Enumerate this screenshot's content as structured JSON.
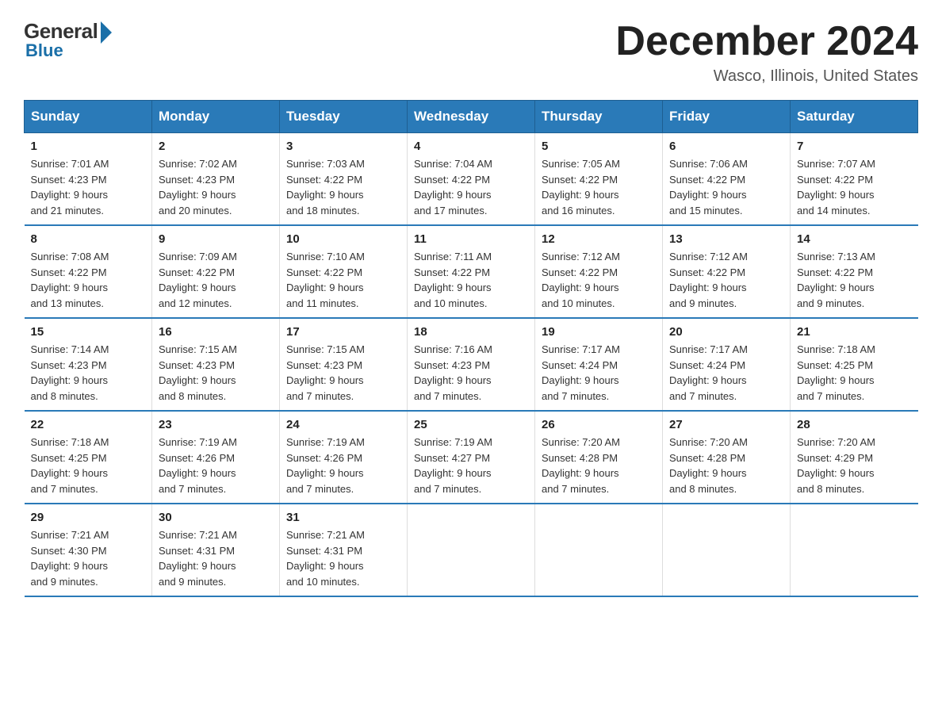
{
  "header": {
    "logo_general": "General",
    "logo_blue": "Blue",
    "month_title": "December 2024",
    "location": "Wasco, Illinois, United States"
  },
  "days_of_week": [
    "Sunday",
    "Monday",
    "Tuesday",
    "Wednesday",
    "Thursday",
    "Friday",
    "Saturday"
  ],
  "weeks": [
    [
      {
        "num": "1",
        "sunrise": "7:01 AM",
        "sunset": "4:23 PM",
        "daylight": "9 hours and 21 minutes."
      },
      {
        "num": "2",
        "sunrise": "7:02 AM",
        "sunset": "4:23 PM",
        "daylight": "9 hours and 20 minutes."
      },
      {
        "num": "3",
        "sunrise": "7:03 AM",
        "sunset": "4:22 PM",
        "daylight": "9 hours and 18 minutes."
      },
      {
        "num": "4",
        "sunrise": "7:04 AM",
        "sunset": "4:22 PM",
        "daylight": "9 hours and 17 minutes."
      },
      {
        "num": "5",
        "sunrise": "7:05 AM",
        "sunset": "4:22 PM",
        "daylight": "9 hours and 16 minutes."
      },
      {
        "num": "6",
        "sunrise": "7:06 AM",
        "sunset": "4:22 PM",
        "daylight": "9 hours and 15 minutes."
      },
      {
        "num": "7",
        "sunrise": "7:07 AM",
        "sunset": "4:22 PM",
        "daylight": "9 hours and 14 minutes."
      }
    ],
    [
      {
        "num": "8",
        "sunrise": "7:08 AM",
        "sunset": "4:22 PM",
        "daylight": "9 hours and 13 minutes."
      },
      {
        "num": "9",
        "sunrise": "7:09 AM",
        "sunset": "4:22 PM",
        "daylight": "9 hours and 12 minutes."
      },
      {
        "num": "10",
        "sunrise": "7:10 AM",
        "sunset": "4:22 PM",
        "daylight": "9 hours and 11 minutes."
      },
      {
        "num": "11",
        "sunrise": "7:11 AM",
        "sunset": "4:22 PM",
        "daylight": "9 hours and 10 minutes."
      },
      {
        "num": "12",
        "sunrise": "7:12 AM",
        "sunset": "4:22 PM",
        "daylight": "9 hours and 10 minutes."
      },
      {
        "num": "13",
        "sunrise": "7:12 AM",
        "sunset": "4:22 PM",
        "daylight": "9 hours and 9 minutes."
      },
      {
        "num": "14",
        "sunrise": "7:13 AM",
        "sunset": "4:22 PM",
        "daylight": "9 hours and 9 minutes."
      }
    ],
    [
      {
        "num": "15",
        "sunrise": "7:14 AM",
        "sunset": "4:23 PM",
        "daylight": "9 hours and 8 minutes."
      },
      {
        "num": "16",
        "sunrise": "7:15 AM",
        "sunset": "4:23 PM",
        "daylight": "9 hours and 8 minutes."
      },
      {
        "num": "17",
        "sunrise": "7:15 AM",
        "sunset": "4:23 PM",
        "daylight": "9 hours and 7 minutes."
      },
      {
        "num": "18",
        "sunrise": "7:16 AM",
        "sunset": "4:23 PM",
        "daylight": "9 hours and 7 minutes."
      },
      {
        "num": "19",
        "sunrise": "7:17 AM",
        "sunset": "4:24 PM",
        "daylight": "9 hours and 7 minutes."
      },
      {
        "num": "20",
        "sunrise": "7:17 AM",
        "sunset": "4:24 PM",
        "daylight": "9 hours and 7 minutes."
      },
      {
        "num": "21",
        "sunrise": "7:18 AM",
        "sunset": "4:25 PM",
        "daylight": "9 hours and 7 minutes."
      }
    ],
    [
      {
        "num": "22",
        "sunrise": "7:18 AM",
        "sunset": "4:25 PM",
        "daylight": "9 hours and 7 minutes."
      },
      {
        "num": "23",
        "sunrise": "7:19 AM",
        "sunset": "4:26 PM",
        "daylight": "9 hours and 7 minutes."
      },
      {
        "num": "24",
        "sunrise": "7:19 AM",
        "sunset": "4:26 PM",
        "daylight": "9 hours and 7 minutes."
      },
      {
        "num": "25",
        "sunrise": "7:19 AM",
        "sunset": "4:27 PM",
        "daylight": "9 hours and 7 minutes."
      },
      {
        "num": "26",
        "sunrise": "7:20 AM",
        "sunset": "4:28 PM",
        "daylight": "9 hours and 7 minutes."
      },
      {
        "num": "27",
        "sunrise": "7:20 AM",
        "sunset": "4:28 PM",
        "daylight": "9 hours and 8 minutes."
      },
      {
        "num": "28",
        "sunrise": "7:20 AM",
        "sunset": "4:29 PM",
        "daylight": "9 hours and 8 minutes."
      }
    ],
    [
      {
        "num": "29",
        "sunrise": "7:21 AM",
        "sunset": "4:30 PM",
        "daylight": "9 hours and 9 minutes."
      },
      {
        "num": "30",
        "sunrise": "7:21 AM",
        "sunset": "4:31 PM",
        "daylight": "9 hours and 9 minutes."
      },
      {
        "num": "31",
        "sunrise": "7:21 AM",
        "sunset": "4:31 PM",
        "daylight": "9 hours and 10 minutes."
      },
      null,
      null,
      null,
      null
    ]
  ],
  "labels": {
    "sunrise": "Sunrise:",
    "sunset": "Sunset:",
    "daylight": "Daylight:"
  }
}
